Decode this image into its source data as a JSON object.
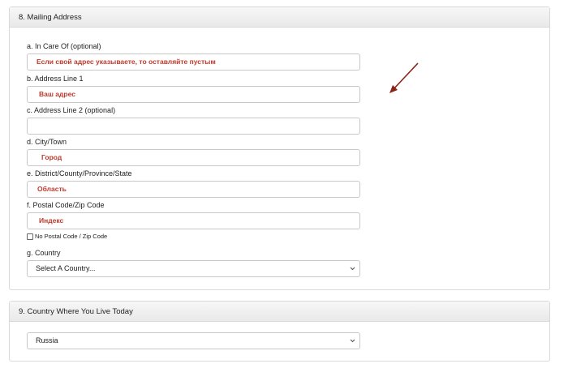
{
  "section8": {
    "title": "8. Mailing Address",
    "care_of": {
      "label": "a. In Care Of (optional)",
      "value": "Если свой адрес указываете, то оставляйте пустым"
    },
    "line1": {
      "label": "b. Address Line 1",
      "value": "Ваш адрес"
    },
    "line2": {
      "label": "c. Address Line 2 (optional)",
      "value": ""
    },
    "city": {
      "label": "d. City/Town",
      "value": "Город"
    },
    "district": {
      "label": "e. District/County/Province/State",
      "value": "Область"
    },
    "postal": {
      "label": "f. Postal Code/Zip Code",
      "value": "Индекс"
    },
    "no_postal_label": "No Postal Code / Zip Code",
    "country": {
      "label": "g. Country",
      "value": "Select A Country..."
    }
  },
  "section9": {
    "title": "9. Country Where You Live Today",
    "country_value": "Russia"
  },
  "colors": {
    "annotation": "#c0392b",
    "arrow": "#8b2318"
  },
  "icons": {
    "select_chevron": "chevron-down-icon",
    "annotation_arrow": "arrow-icon"
  }
}
